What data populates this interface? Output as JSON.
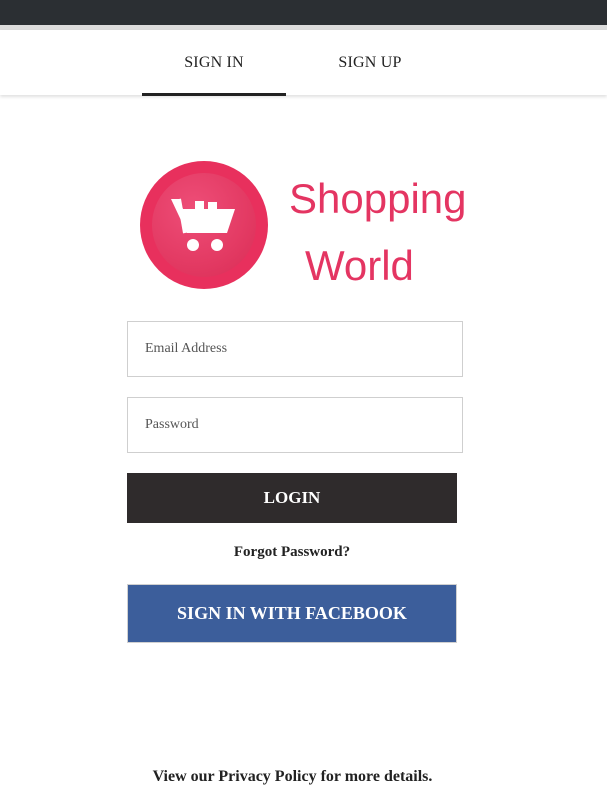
{
  "tabs": [
    {
      "label": "SIGN IN",
      "active": true
    },
    {
      "label": "SIGN UP",
      "active": false
    }
  ],
  "brand": {
    "line1": "Shopping",
    "line2": "World",
    "logo_icon": "shopping-cart-icon",
    "color": "#e43562"
  },
  "form": {
    "email_placeholder": "Email Address",
    "password_placeholder": "Password",
    "login_label": "LOGIN",
    "forgot_label": "Forgot Password?",
    "facebook_label": "SIGN IN WITH FACEBOOK"
  },
  "footer": {
    "privacy_prefix": "View our ",
    "privacy_link": "Privacy Policy",
    "privacy_suffix": " for more details."
  },
  "colors": {
    "login_button": "#2f2b2c",
    "facebook_button": "#3c5e9b",
    "top_bar": "#2b2f33"
  }
}
